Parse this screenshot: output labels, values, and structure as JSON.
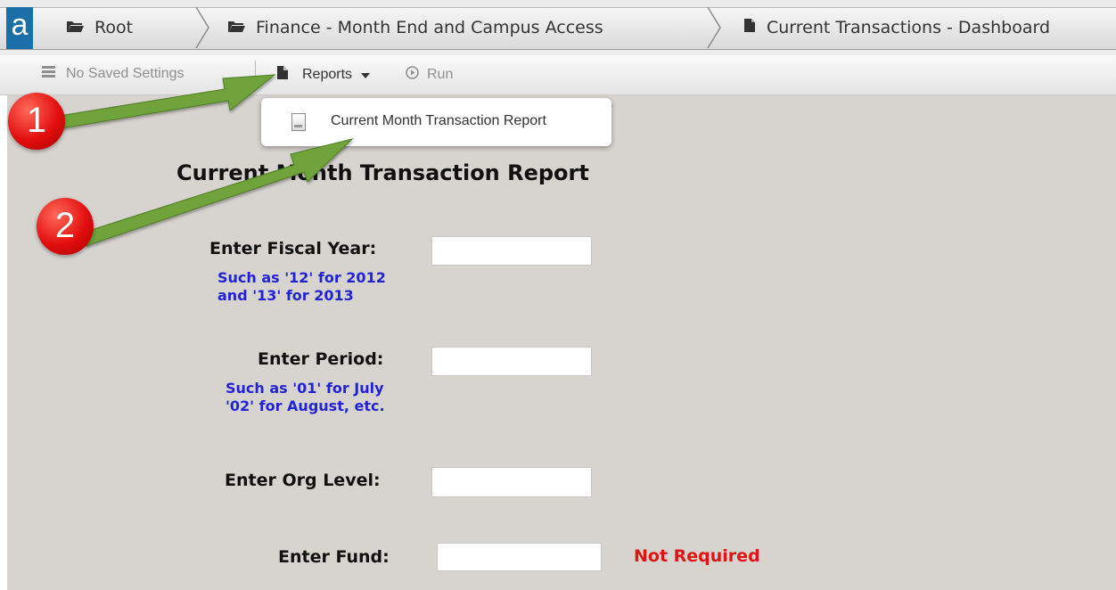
{
  "breadcrumb": {
    "logo": "a",
    "items": [
      {
        "label": "Root",
        "icon": "folder-icon"
      },
      {
        "label": "Finance - Month End and Campus Access",
        "icon": "folder-icon"
      },
      {
        "label": "Current Transactions - Dashboard",
        "icon": "document-icon"
      }
    ]
  },
  "toolbar": {
    "saved_settings": "No Saved Settings",
    "reports": "Reports",
    "run": "Run"
  },
  "dropdown": {
    "items": [
      {
        "label": "Current Month Transaction Report"
      }
    ]
  },
  "form": {
    "title": "Current Month Transaction Report",
    "fiscal_year": {
      "label": "Enter Fiscal Year:",
      "hint_1": "Such as '12' for 2012",
      "hint_2": "and '13' for 2013",
      "value": ""
    },
    "period": {
      "label": "Enter Period:",
      "hint_1": "Such as '01' for July",
      "hint_2": "'02' for August, etc.",
      "value": ""
    },
    "org_level": {
      "label": "Enter Org Level:",
      "value": ""
    },
    "fund": {
      "label": "Enter Fund:",
      "value": "",
      "note": "Not Required"
    }
  },
  "annotations": {
    "step_1": "1",
    "step_2": "2",
    "arrow_color": "#6fa33a",
    "badge_color": "#e01414"
  }
}
